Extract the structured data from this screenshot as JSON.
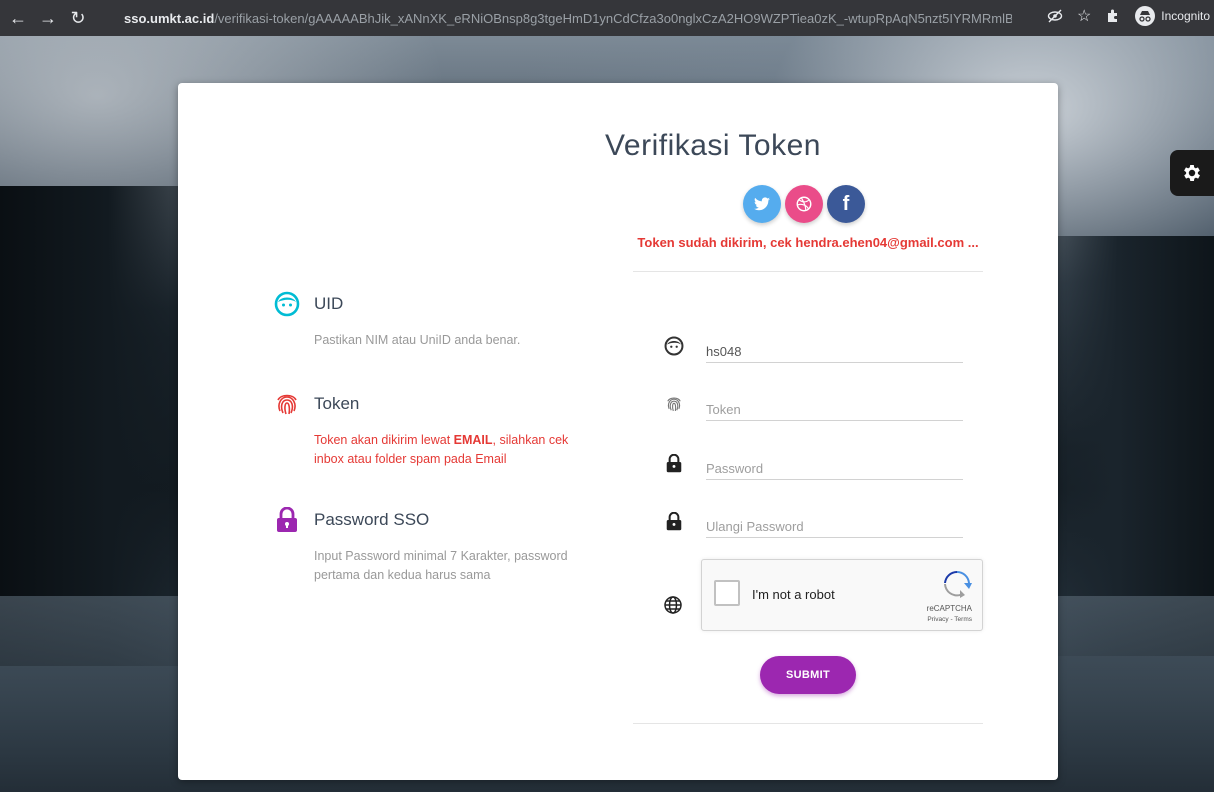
{
  "browser": {
    "url_domain": "sso.umkt.ac.id",
    "url_path": "/verifikasi-token/gAAAAABhJik_xANnXK_eRNiOBnsp8g3tgeHmD1ynCdCfza3o0nglxCzA2HO9WZPTiea0zK_-wtupRpAqN5nzt5IYRMRmlB...",
    "incognito_label": "Incognito"
  },
  "card": {
    "title": "Verifikasi Token",
    "token_message": "Token sudah dikirim, cek hendra.ehen04@gmail.com ..."
  },
  "social": [
    {
      "name": "twitter",
      "glyph": "✉"
    },
    {
      "name": "dribbble",
      "glyph": "◎"
    },
    {
      "name": "facebook",
      "glyph": "f"
    }
  ],
  "info": {
    "uid": {
      "title": "UID",
      "desc": "Pastikan NIM atau UniID anda benar."
    },
    "token": {
      "title": "Token",
      "desc_pre": "Token akan dikirim lewat ",
      "desc_bold": "EMAIL",
      "desc_post": ", silahkan cek inbox atau folder spam pada Email"
    },
    "password": {
      "title": "Password SSO",
      "desc": "Input Password minimal 7 Karakter, password pertama dan kedua harus sama"
    }
  },
  "form": {
    "uid_value": "hs048",
    "token_placeholder": "Token",
    "password_placeholder": "Password",
    "repeat_password_placeholder": "Ulangi Password",
    "captcha_label": "I'm not a robot",
    "captcha_brand": "reCAPTCHA",
    "captcha_terms": "Privacy - Terms",
    "submit_label": "SUBMIT"
  },
  "colors": {
    "accent_purple": "#9c27b0",
    "error_red": "#e53935",
    "uid_cyan": "#00bcd4"
  }
}
